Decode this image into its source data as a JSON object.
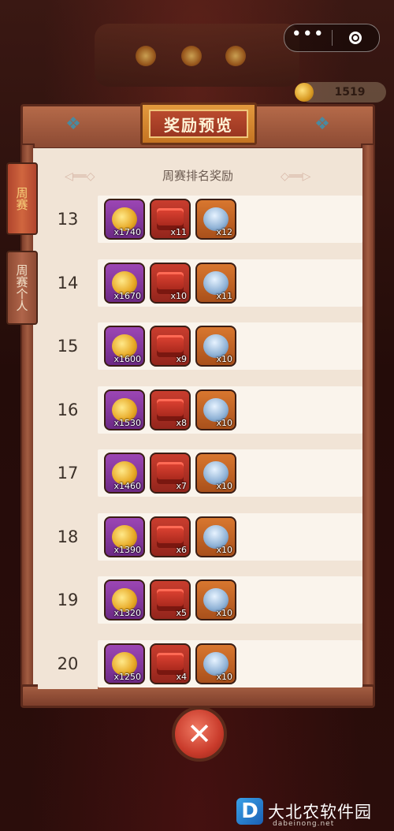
{
  "capsule": {
    "more_icon": "more-dots-icon",
    "close_icon": "target-icon"
  },
  "currency": {
    "value": "1519",
    "icon": "gold-coin-icon"
  },
  "panel": {
    "title": "奖励预览",
    "subtitle": "周赛排名奖励"
  },
  "tabs": [
    {
      "label": "周赛",
      "active": true
    },
    {
      "label": "周赛个人",
      "active": false
    }
  ],
  "rows": [
    {
      "rank": "13",
      "items": [
        {
          "type": "coin",
          "qty": "x1740"
        },
        {
          "type": "chest",
          "qty": "x11"
        },
        {
          "type": "bowl",
          "qty": "x12"
        }
      ]
    },
    {
      "rank": "14",
      "items": [
        {
          "type": "coin",
          "qty": "x1670"
        },
        {
          "type": "chest",
          "qty": "x10"
        },
        {
          "type": "bowl",
          "qty": "x11"
        }
      ]
    },
    {
      "rank": "15",
      "items": [
        {
          "type": "coin",
          "qty": "x1600"
        },
        {
          "type": "chest",
          "qty": "x9"
        },
        {
          "type": "bowl",
          "qty": "x10"
        }
      ]
    },
    {
      "rank": "16",
      "items": [
        {
          "type": "coin",
          "qty": "x1530"
        },
        {
          "type": "chest",
          "qty": "x8"
        },
        {
          "type": "bowl",
          "qty": "x10"
        }
      ]
    },
    {
      "rank": "17",
      "items": [
        {
          "type": "coin",
          "qty": "x1460"
        },
        {
          "type": "chest",
          "qty": "x7"
        },
        {
          "type": "bowl",
          "qty": "x10"
        }
      ]
    },
    {
      "rank": "18",
      "items": [
        {
          "type": "coin",
          "qty": "x1390"
        },
        {
          "type": "chest",
          "qty": "x6"
        },
        {
          "type": "bowl",
          "qty": "x10"
        }
      ]
    },
    {
      "rank": "19",
      "items": [
        {
          "type": "coin",
          "qty": "x1320"
        },
        {
          "type": "chest",
          "qty": "x5"
        },
        {
          "type": "bowl",
          "qty": "x10"
        }
      ]
    },
    {
      "rank": "20",
      "items": [
        {
          "type": "coin",
          "qty": "x1250"
        },
        {
          "type": "chest",
          "qty": "x4"
        },
        {
          "type": "bowl",
          "qty": "x10"
        }
      ]
    }
  ],
  "close_button": {
    "symbol": "✕"
  },
  "watermark": {
    "logo": "D",
    "text": "大北农软件园",
    "sub": "dabeinong.net"
  }
}
